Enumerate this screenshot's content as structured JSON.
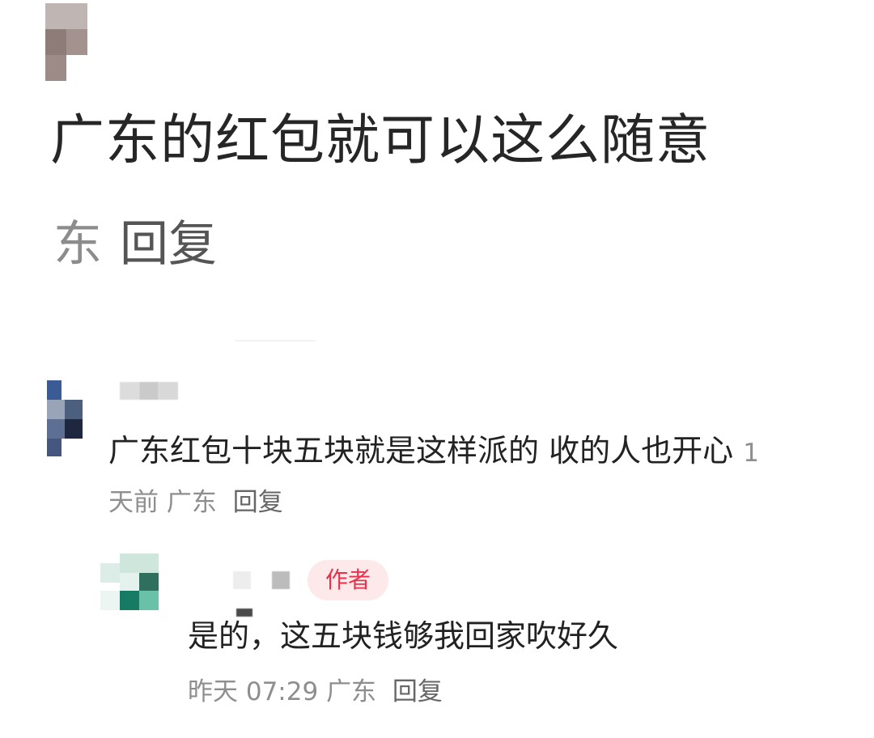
{
  "post": {
    "title": "广东的红包就可以这么随意",
    "location": "东",
    "reply_label": "回复"
  },
  "comments": [
    {
      "text": "广东红包十块五块就是这样派的  收的人也开心",
      "time": "1天前",
      "location": "广东",
      "reply_label": "回复",
      "replies": [
        {
          "badge": "作者",
          "text": "是的，这五块钱够我回家吹好久",
          "time": "昨天 07:29",
          "location": "广东",
          "reply_label": "回复"
        }
      ]
    }
  ],
  "colors": {
    "badge_bg": "#fde8ea",
    "badge_text": "#e8324b",
    "meta_text": "#8e8e8e"
  }
}
